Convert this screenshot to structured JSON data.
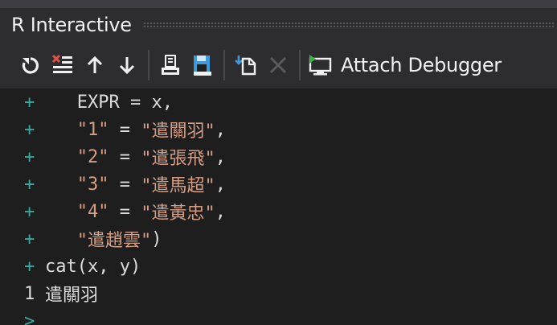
{
  "window": {
    "title": "R Interactive"
  },
  "toolbar": {
    "buttons": [
      {
        "name": "reset-icon",
        "label": "Reset"
      },
      {
        "name": "clear-icon",
        "label": "Clear"
      },
      {
        "name": "history-up-icon",
        "label": "Previous history"
      },
      {
        "name": "history-down-icon",
        "label": "Next history"
      },
      {
        "name": "load-workspace-icon",
        "label": "Load workspace"
      },
      {
        "name": "save-workspace-icon",
        "label": "Save workspace"
      },
      {
        "name": "set-directory-icon",
        "label": "Set working directory"
      },
      {
        "name": "interrupt-icon",
        "label": "Interrupt"
      }
    ],
    "attach_label": "Attach Debugger"
  },
  "console": {
    "lines": [
      {
        "prompt": "+",
        "segments": [
          {
            "t": "plain",
            "v": "   EXPR = x,"
          }
        ]
      },
      {
        "prompt": "+",
        "segments": [
          {
            "t": "plain",
            "v": "   "
          },
          {
            "t": "str",
            "v": "\"1\""
          },
          {
            "t": "plain",
            "v": " = "
          },
          {
            "t": "str",
            "v": "\"遣關羽\""
          },
          {
            "t": "plain",
            "v": ","
          }
        ]
      },
      {
        "prompt": "+",
        "segments": [
          {
            "t": "plain",
            "v": "   "
          },
          {
            "t": "str",
            "v": "\"2\""
          },
          {
            "t": "plain",
            "v": " = "
          },
          {
            "t": "str",
            "v": "\"遣張飛\""
          },
          {
            "t": "plain",
            "v": ","
          }
        ]
      },
      {
        "prompt": "+",
        "segments": [
          {
            "t": "plain",
            "v": "   "
          },
          {
            "t": "str",
            "v": "\"3\""
          },
          {
            "t": "plain",
            "v": " = "
          },
          {
            "t": "str",
            "v": "\"遣馬超\""
          },
          {
            "t": "plain",
            "v": ","
          }
        ]
      },
      {
        "prompt": "+",
        "segments": [
          {
            "t": "plain",
            "v": "   "
          },
          {
            "t": "str",
            "v": "\"4\""
          },
          {
            "t": "plain",
            "v": " = "
          },
          {
            "t": "str",
            "v": "\"遣黃忠\""
          },
          {
            "t": "plain",
            "v": ","
          }
        ]
      },
      {
        "prompt": "+",
        "segments": [
          {
            "t": "plain",
            "v": "   "
          },
          {
            "t": "str",
            "v": "\"遣趙雲\""
          },
          {
            "t": "plain",
            "v": ")"
          }
        ]
      },
      {
        "prompt": "+",
        "segments": [
          {
            "t": "plain",
            "v": "cat(x, y)"
          }
        ]
      },
      {
        "prompt": "1",
        "segments": [
          {
            "t": "out",
            "v": "遣關羽"
          }
        ]
      },
      {
        "prompt": ">",
        "segments": []
      }
    ]
  },
  "colors": {
    "background": "#1e1e1e",
    "toolbar": "#2d2d30",
    "prompt": "#3ba8a0",
    "string": "#d69d85",
    "text": "#dcdcdc"
  }
}
